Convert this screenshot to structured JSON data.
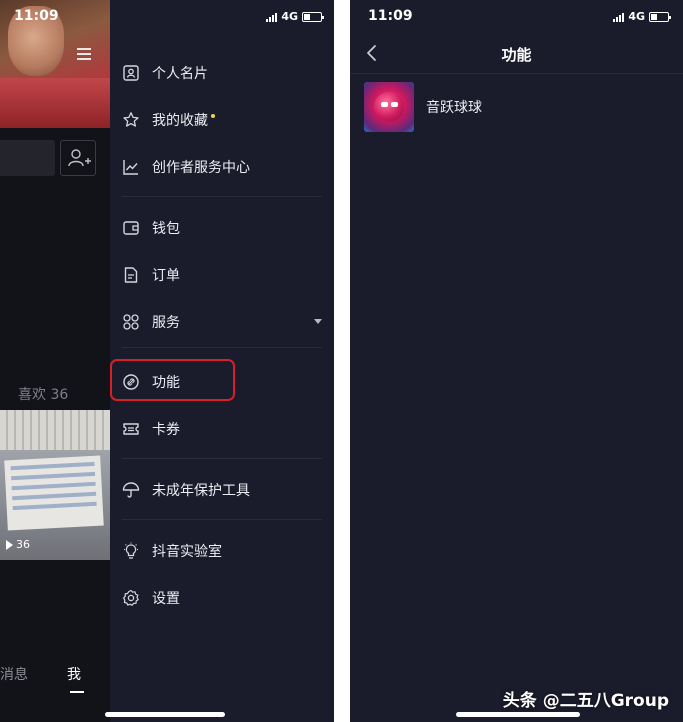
{
  "left_screen": {
    "status": {
      "time": "11:09",
      "network": "4G"
    },
    "profile": {
      "likes_label": "喜欢 36",
      "play_count": "36"
    },
    "bottom_tabs": {
      "messages": "消息",
      "me": "我"
    },
    "drawer_menu": [
      {
        "label": "个人名片",
        "icon": "contact-card-icon"
      },
      {
        "label": "我的收藏",
        "icon": "star-icon",
        "new_dot": true
      },
      {
        "label": "创作者服务中心",
        "icon": "chart-icon"
      },
      {
        "label": "钱包",
        "icon": "wallet-icon"
      },
      {
        "label": "订单",
        "icon": "order-icon"
      },
      {
        "label": "服务",
        "icon": "grid-icon",
        "expandable": true
      },
      {
        "label": "功能",
        "icon": "link-icon",
        "highlighted": true
      },
      {
        "label": "卡券",
        "icon": "ticket-icon"
      },
      {
        "label": "未成年保护工具",
        "icon": "umbrella-icon"
      },
      {
        "label": "抖音实验室",
        "icon": "bulb-icon"
      },
      {
        "label": "设置",
        "icon": "gear-icon"
      }
    ],
    "highlight_color": "#d81e2a"
  },
  "right_screen": {
    "status": {
      "time": "11:09",
      "network": "4G"
    },
    "title": "功能",
    "items": [
      {
        "name": "音跃球球",
        "icon": "game-app-icon"
      }
    ]
  },
  "watermark": "头条 @二五八Group",
  "colors": {
    "drawer_bg": "#1b1c2b",
    "text": "#ecedf2"
  }
}
